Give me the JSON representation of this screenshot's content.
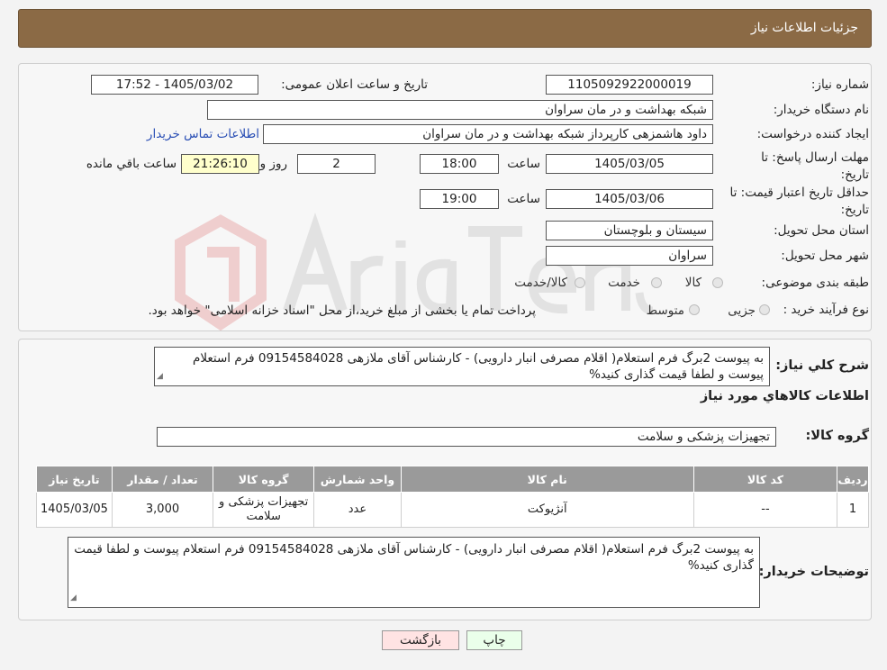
{
  "header": {
    "title": "جزئیات اطلاعات نیاز"
  },
  "form": {
    "need_number_label": "شماره نیاز:",
    "need_number": "1105092922000019",
    "announce_label": "تاریخ و ساعت اعلان عمومی:",
    "announce_value": "1405/03/02 - 17:52",
    "buyer_label": "نام دستگاه خریدار:",
    "buyer_value": "شبکه بهداشت و در مان سراوان",
    "creator_label": "ایجاد کننده درخواست:",
    "creator_value": "داود هاشمزهی  کارپرداز شبکه بهداشت و در مان سراوان",
    "contact_link": "اطلاعات تماس خریدار",
    "deadline_label_1": "مهلت ارسال پاسخ: تا",
    "deadline_label_2": "تاریخ:",
    "deadline_date": "1405/03/05",
    "hour_label": "ساعت",
    "deadline_hour": "18:00",
    "days_value": "2",
    "days_label": "روز و",
    "remaining_time": "21:26:10",
    "remaining_label": "ساعت باقي مانده",
    "validity_label_1": "حداقل تاریخ اعتبار قیمت: تا",
    "validity_label_2": "تاریخ:",
    "validity_date": "1405/03/06",
    "validity_hour": "19:00",
    "province_label": "استان محل تحویل:",
    "province_value": "سیستان و بلوچستان",
    "city_label": "شهر محل تحویل:",
    "city_value": "سراوان",
    "category_label": "طبقه بندی موضوعی:",
    "category_options": [
      "کالا",
      "خدمت",
      "کالا/خدمت"
    ],
    "process_label": "نوع فرآیند خرید :",
    "process_options": [
      "جزیی",
      "متوسط"
    ],
    "process_note": "پرداخت تمام یا بخشی از مبلغ خرید،از محل \"اسناد خزانه اسلامی\" خواهد بود."
  },
  "summary": {
    "label": "شرح کلي نياز:",
    "text": "به پیوست 2برگ فرم استعلام( اقلام مصرفی انبار دارویی) - کارشناس آقای ملازهی  09154584028 فرم استعلام پیوست و لطفا قیمت گذاری کنید%",
    "goods_info_title": "اطلاعات کالاهاي مورد نياز",
    "goods_group_label": "گروه کالا:",
    "goods_group_value": "تجهیزات پزشکی و سلامت"
  },
  "table": {
    "headers": [
      "ردیف",
      "کد کالا",
      "نام کالا",
      "واحد شمارش",
      "گروه کالا",
      "تعداد / مقدار",
      "تاریخ نیاز"
    ],
    "rows": [
      [
        "1",
        "--",
        "آنژیوکت",
        "عدد",
        "تجهیزات پزشکی و سلامت",
        "3,000",
        "1405/03/05"
      ]
    ]
  },
  "buyer_notes": {
    "label": "توضیحات خریدار:",
    "text": "به پیوست 2برگ فرم استعلام( اقلام مصرفی انبار دارویی) - کارشناس آقای ملازهی  09154584028 فرم استعلام پیوست و لطفا قیمت گذاری کنید%"
  },
  "buttons": {
    "print": "چاپ",
    "back": "بازگشت"
  },
  "colors": {
    "header_bg": "#8b6a45",
    "print_bg": "#eaffea",
    "back_bg": "#ffe3e3",
    "link": "#2a4fb5"
  }
}
